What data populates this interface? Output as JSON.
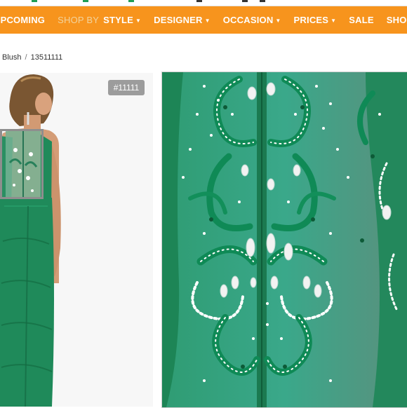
{
  "nav": {
    "items": [
      {
        "label": "UPCOMING",
        "caret": false
      },
      {
        "label": "SHOP BY",
        "caret": false,
        "muted": true
      },
      {
        "label": "STYLE",
        "caret": true
      },
      {
        "label": "DESIGNER",
        "caret": true
      },
      {
        "label": "OCCASION",
        "caret": true
      },
      {
        "label": "PRICES",
        "caret": true
      },
      {
        "label": "SALE",
        "caret": false
      },
      {
        "label": "SHOES",
        "caret": false
      }
    ],
    "bg_color": "#f7941d"
  },
  "breadcrumb": {
    "items": [
      "Blush",
      "13511111"
    ],
    "separator": "/"
  },
  "product": {
    "sku_badge": "#11111",
    "thumbnail_icon": "dress-back-photo",
    "zoom_icon": "beaded-back-detail-photo",
    "dress_color": "#1f8a5a"
  }
}
